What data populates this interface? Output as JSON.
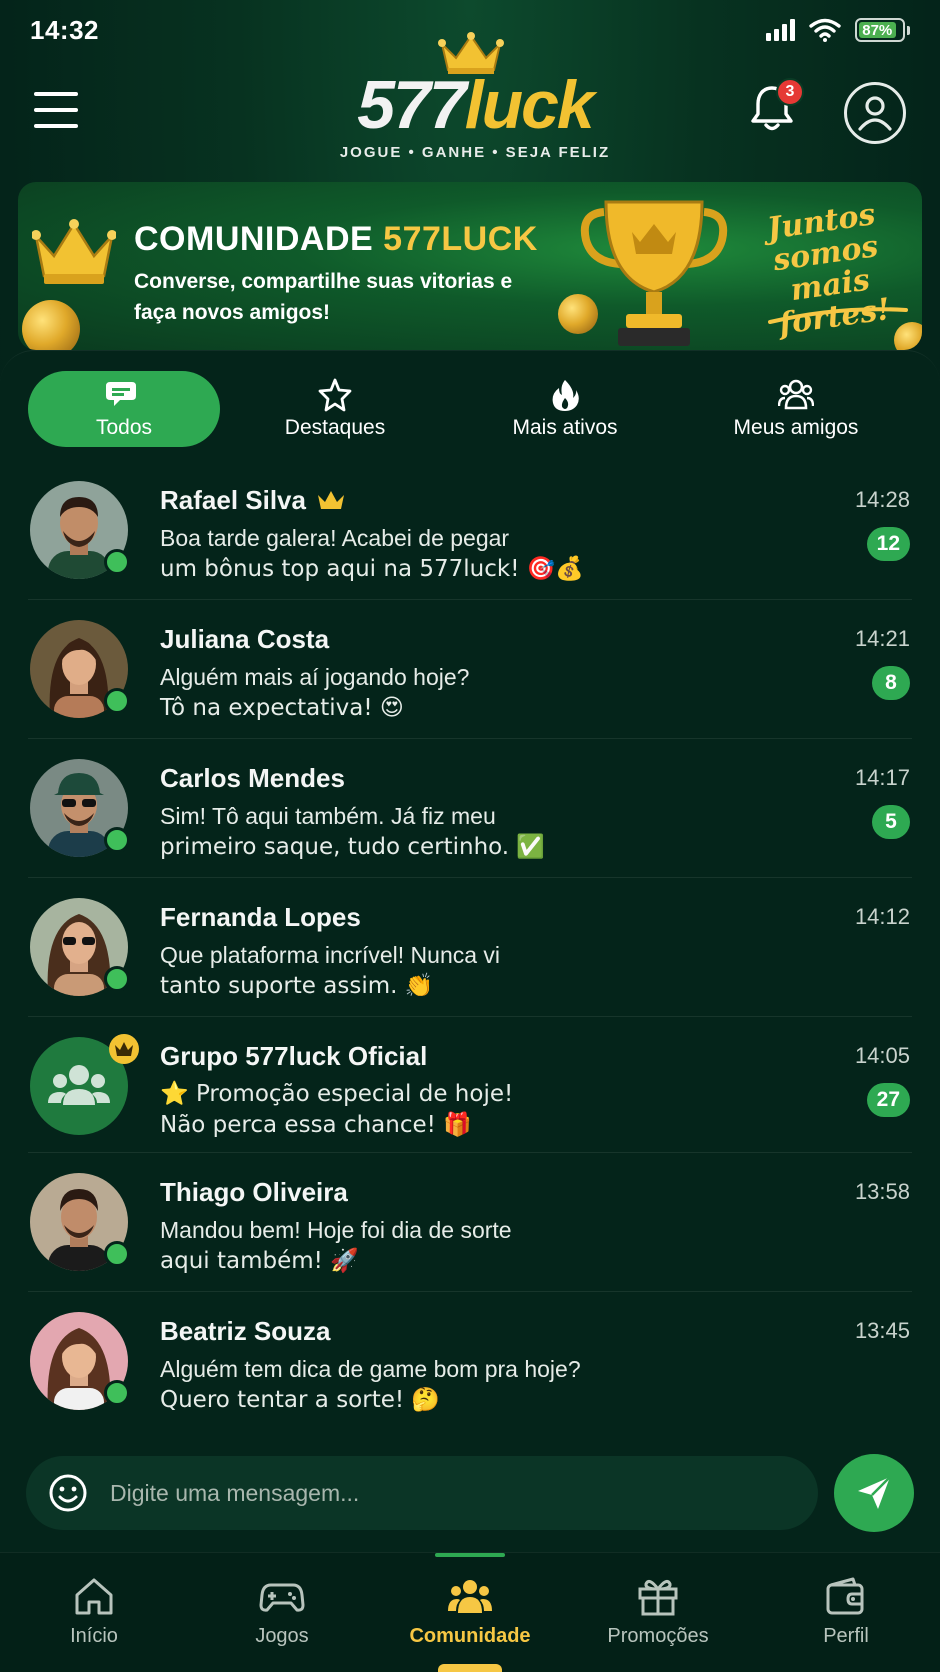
{
  "status_bar": {
    "time": "14:32",
    "battery": "87%"
  },
  "header": {
    "logo_number": "577",
    "logo_word": "luck",
    "tagline": "JOGUE • GANHE • SEJA FELIZ",
    "notification_count": "3"
  },
  "banner": {
    "title_prefix": "COMUNIDADE ",
    "title_accent": "577LUCK",
    "subtitle": "Converse, compartilhe suas vitorias e faça novos amigos!",
    "slogan": "Juntos somos mais fortes!"
  },
  "tabs": [
    {
      "label": "Todos",
      "icon": "chat-bubbles-icon",
      "active": true
    },
    {
      "label": "Destaques",
      "icon": "star-icon",
      "active": false
    },
    {
      "label": "Mais ativos",
      "icon": "fire-icon",
      "active": false
    },
    {
      "label": "Meus amigos",
      "icon": "friends-icon",
      "active": false
    }
  ],
  "chats": [
    {
      "name": "Rafael Silva",
      "crown": true,
      "line1": "Boa tarde galera! Acabei de pegar",
      "line2": "um bônus top aqui na 577luck! 🎯💰",
      "time": "14:28",
      "unread": "12",
      "online": true
    },
    {
      "name": "Juliana Costa",
      "crown": false,
      "line1": "Alguém mais aí jogando hoje?",
      "line2": "Tô na expectativa! 😍",
      "time": "14:21",
      "unread": "8",
      "online": true
    },
    {
      "name": "Carlos Mendes",
      "crown": false,
      "line1": "Sim! Tô aqui também. Já fiz meu",
      "line2": "primeiro saque, tudo certinho. ✅",
      "time": "14:17",
      "unread": "5",
      "online": true
    },
    {
      "name": "Fernanda Lopes",
      "crown": false,
      "line1": "Que plataforma incrível! Nunca vi",
      "line2": "tanto suporte assim. 👏",
      "time": "14:12",
      "unread": "",
      "online": true
    },
    {
      "name": "Grupo 577luck Oficial",
      "crown": false,
      "group": true,
      "line1": "⭐ Promoção especial de hoje!",
      "line2": "Não perca essa chance! 🎁",
      "time": "14:05",
      "unread": "27",
      "online": false
    },
    {
      "name": "Thiago Oliveira",
      "crown": false,
      "line1": "Mandou bem! Hoje foi dia de sorte",
      "line2": "aqui também! 🚀",
      "time": "13:58",
      "unread": "",
      "online": true
    },
    {
      "name": "Beatriz Souza",
      "crown": false,
      "line1": "Alguém tem dica de game bom pra hoje?",
      "line2": "Quero tentar a sorte! 🤔",
      "time": "13:45",
      "unread": "",
      "online": true
    }
  ],
  "composer": {
    "placeholder": "Digite uma mensagem..."
  },
  "bottom_nav": [
    {
      "label": "Início",
      "icon": "home-icon",
      "active": false
    },
    {
      "label": "Jogos",
      "icon": "gamepad-icon",
      "active": false
    },
    {
      "label": "Comunidade",
      "icon": "community-icon",
      "active": true
    },
    {
      "label": "Promoções",
      "icon": "gift-icon",
      "active": false
    },
    {
      "label": "Perfil",
      "icon": "wallet-icon",
      "active": false
    }
  ],
  "colors": {
    "accent_green": "#2ea952",
    "accent_gold": "#f6c744",
    "background": "#04241a",
    "badge_red": "#e53935"
  }
}
